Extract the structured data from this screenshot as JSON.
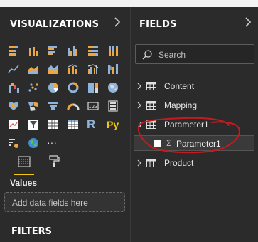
{
  "visualizations": {
    "title": "VISUALIZATIONS",
    "icons": [
      "stacked-bar-chart-icon",
      "stacked-column-chart-icon",
      "clustered-bar-chart-icon",
      "clustered-column-chart-icon",
      "100-stacked-bar-chart-icon",
      "100-stacked-column-chart-icon",
      "line-chart-icon",
      "area-chart-icon",
      "stacked-area-chart-icon",
      "line-and-column-chart-icon",
      "line-and-clustered-column-chart-icon",
      "ribbon-chart-icon",
      "waterfall-chart-icon",
      "scatter-chart-icon",
      "pie-chart-icon",
      "donut-chart-icon",
      "treemap-icon",
      "map-icon",
      "filled-map-icon",
      "shape-map-icon",
      "funnel-icon",
      "gauge-icon",
      "card-icon",
      "multi-row-card-icon",
      "kpi-icon",
      "slicer-icon",
      "table-icon",
      "matrix-icon",
      "r-visual-icon",
      "python-visual-icon",
      "key-influencers-icon",
      "globe-icon",
      "more-visuals-icon"
    ],
    "r_label": "R",
    "py_label": "Py",
    "more_label": "···",
    "values_label": "Values",
    "drop_placeholder": "Add data fields here"
  },
  "filters": {
    "title": "FILTERS"
  },
  "fields": {
    "title": "FIELDS",
    "search_placeholder": "Search",
    "tables": [
      {
        "name": "Content"
      },
      {
        "name": "Mapping"
      },
      {
        "name": "Parameter1"
      },
      {
        "name": "Product"
      }
    ],
    "parameter_field": {
      "sigma": "Σ",
      "name": "Parameter1"
    }
  },
  "colors": {
    "accent": "#f2c811",
    "pane_bg": "#2b2b2b",
    "annotation": "#c8191e"
  }
}
